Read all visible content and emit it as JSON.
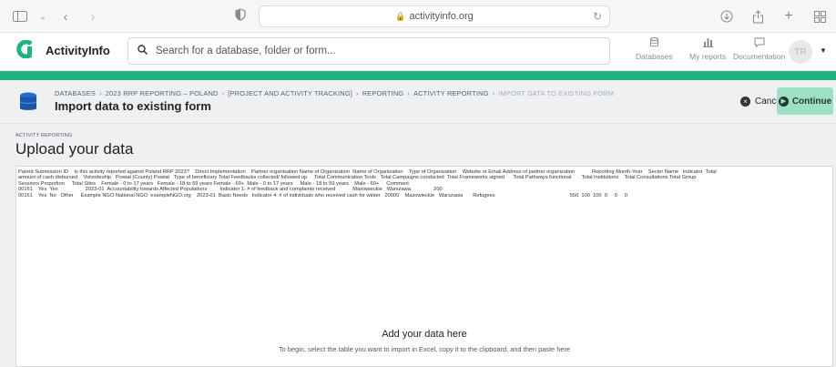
{
  "browser": {
    "url": "activityinfo.org"
  },
  "app": {
    "name": "ActivityInfo",
    "search_placeholder": "Search for a database, folder or form...",
    "nav": [
      {
        "label": "Databases",
        "icon": "database-icon"
      },
      {
        "label": "My reports",
        "icon": "bar-chart-icon"
      },
      {
        "label": "Documentation",
        "icon": "chat-icon"
      }
    ],
    "avatar_initials": "TR",
    "accent_color": "#20b281"
  },
  "page_header": {
    "breadcrumb": [
      "DATABASES",
      "2023 RRP REPORTING – POLAND",
      "[PROJECT AND ACTIVITY TRACKING]",
      "REPORTING",
      "ACTIVITY REPORTING",
      "IMPORT DATA TO EXISTING FORM"
    ],
    "title": "Import data to existing form",
    "cancel_label": "Cancel",
    "continue_label": "Continue"
  },
  "upload": {
    "eyebrow": "ACTIVITY REPORTING",
    "title": "Upload your data",
    "pasted_lines": [
      "Parent Submission ID    Is this activity reported against Poland RRP 2023?    Direct Implementation    Partner organisation Name of Organization  Name of Organization    Type of Organization    Website or Email Address of partner organization            Reporting Month-Year    Sector Name   Indicator  Total",
      "amount of cash disbursed    Voivodeship   Powiat (County) Powiat   Type of beneficiary Total Feedbacks collected/ followed up     Total Communication Tools   Total Campaigns conducted  Total Frameworks signed      Total Pathways functional       Total Institutions    Total Consultations Total Group",
      "Sessions Proportion     Total Sites    Female - 0 to 17 years   Female - 18 to 59 years Female - 60+  Male - 0 to 17 years     Male - 18 to 59 years    Male - 60+     Comment",
      "00161    Yes  Yes                   2023-01  Accountability towards Affected Populations         Indicator 1: # of feedback and complaints received            Mazowieckie   Warszawa                200",
      "00161    Yes  No   Other     Example NGO National NGO  exampleNGO.org    2023-01  Basic Needs   Indicator 4: # of individuals who received cash for winter   20000    Mazowieckie   Warszawa       Refugees                                                    550  100  100  0     0     0"
    ],
    "add_title": "Add your data here",
    "add_hint": "To begin, select the table you want to import in Excel, copy it to the clipboard, and then paste here"
  }
}
